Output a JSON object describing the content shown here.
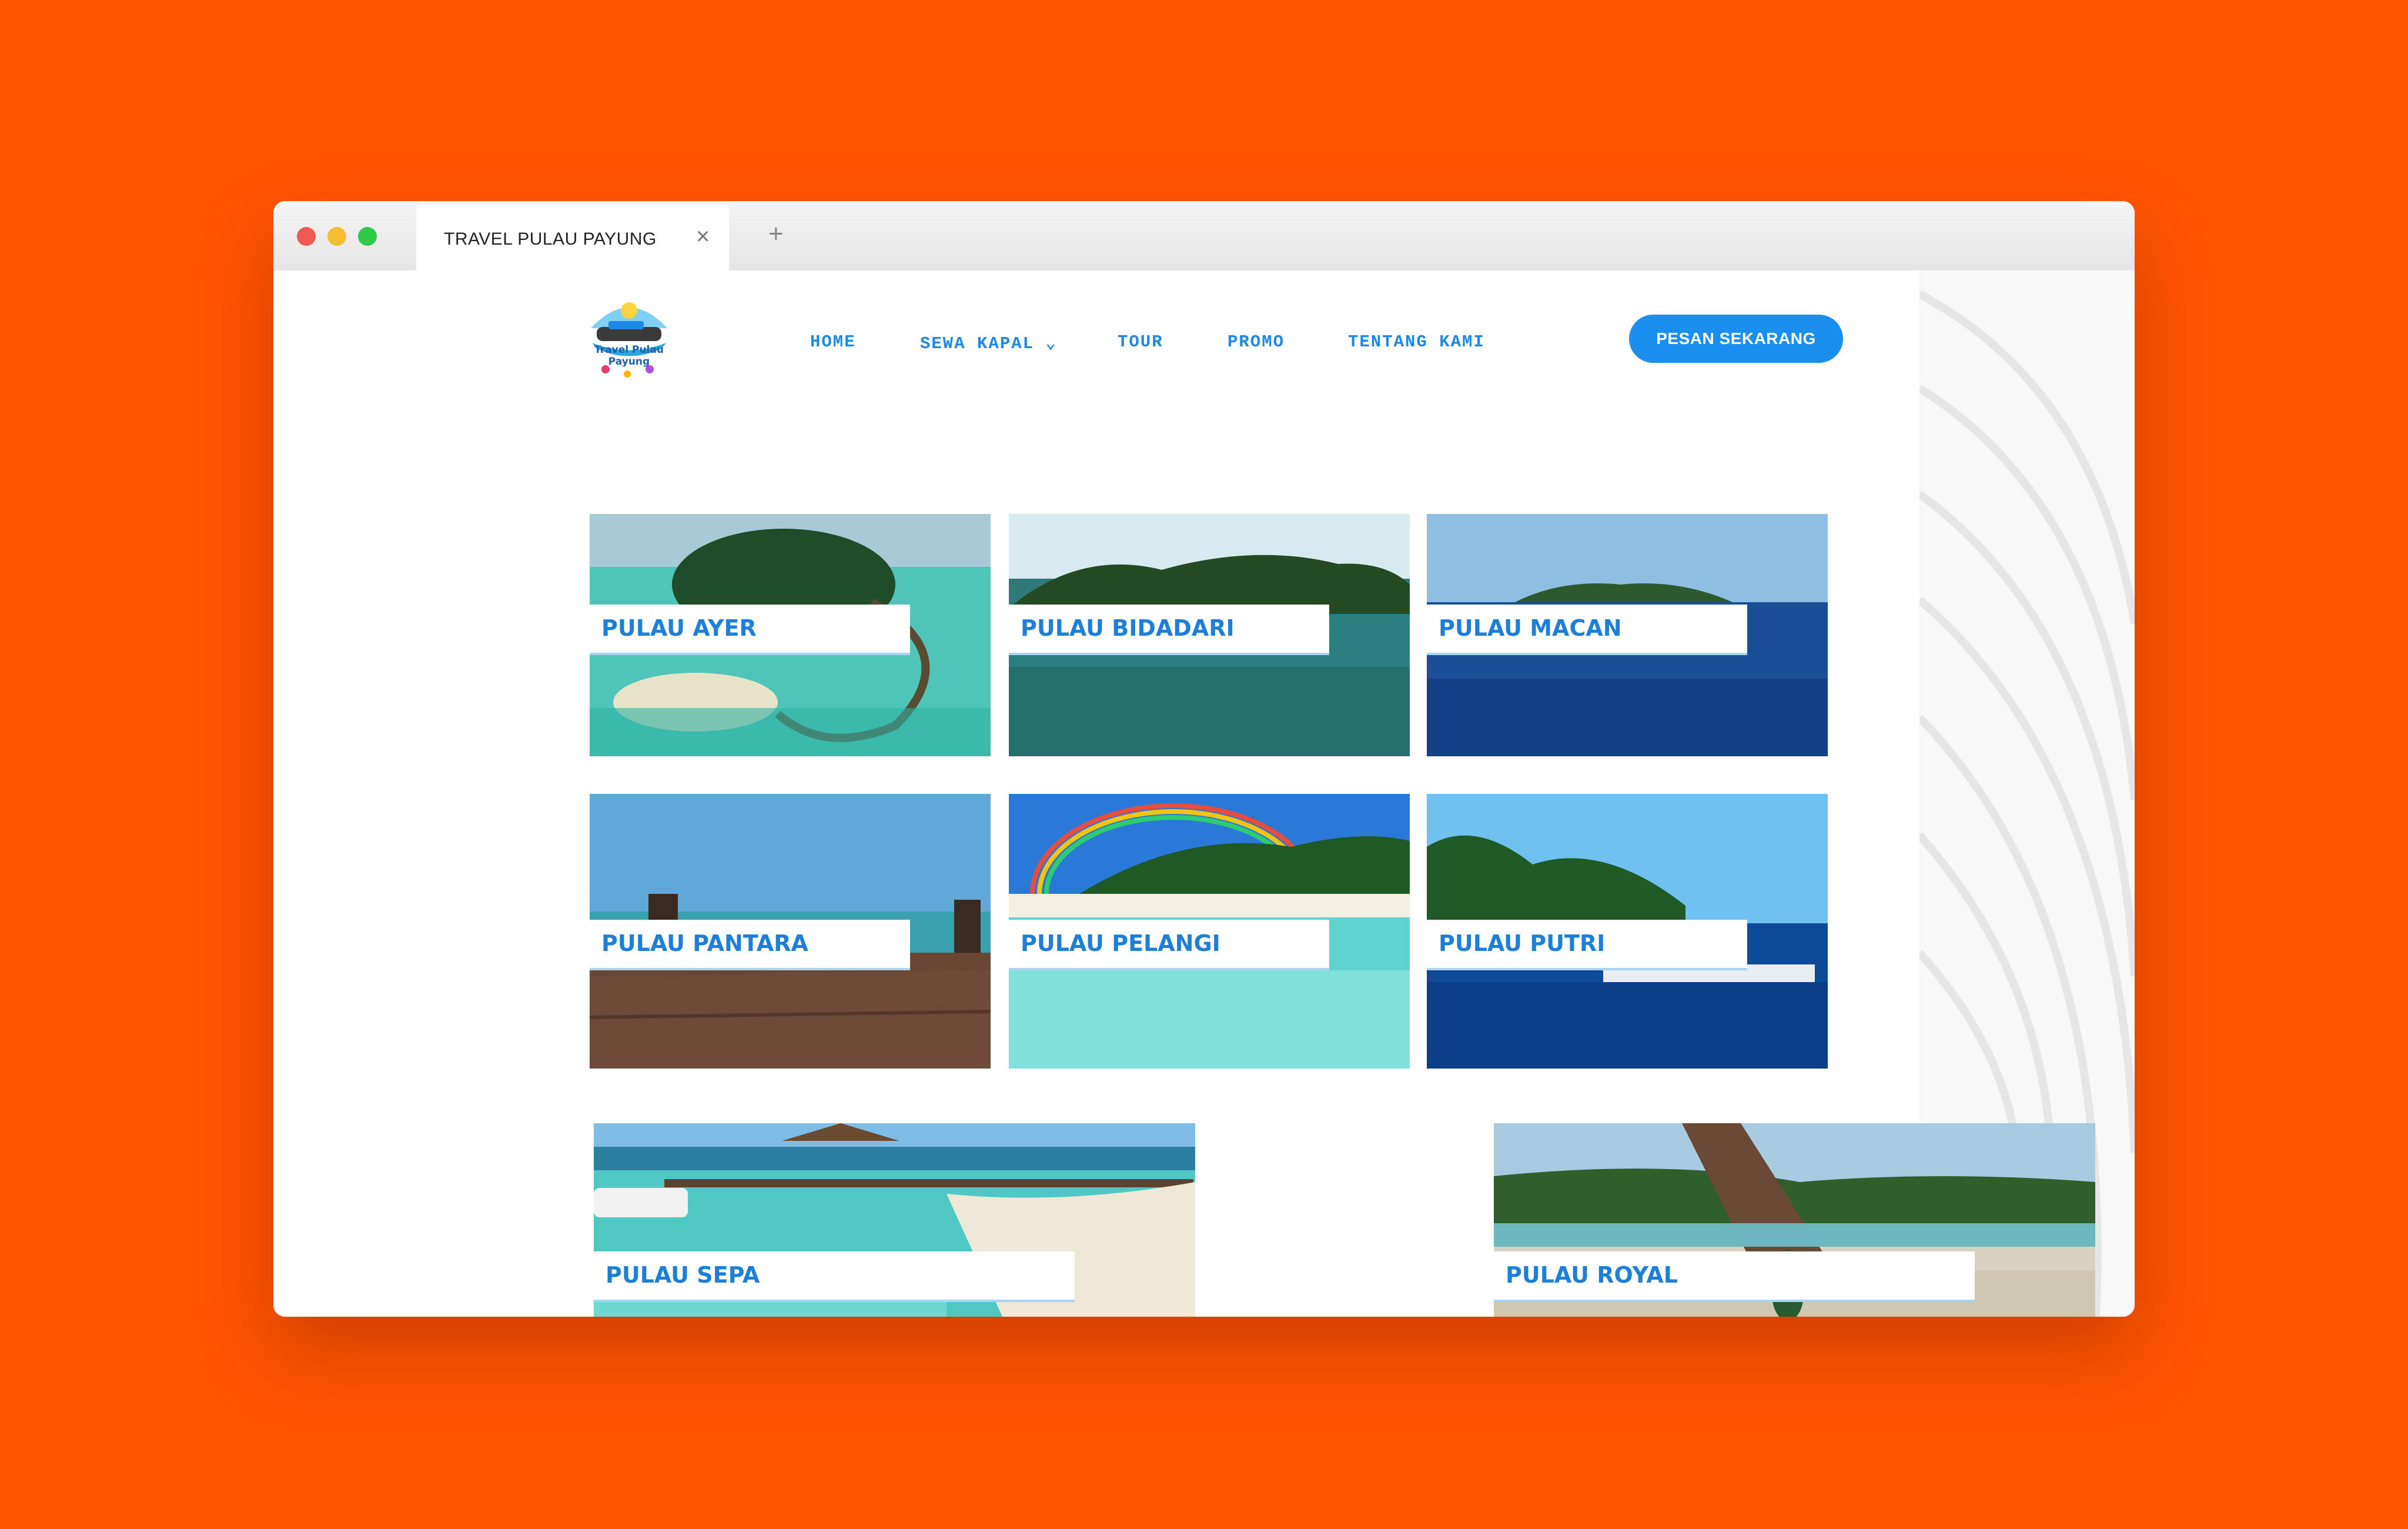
{
  "browser": {
    "tab_title": "TRAVEL PULAU PAYUNG",
    "close_glyph": "×",
    "new_tab_glyph": "+"
  },
  "logo": {
    "text_line1": "Travel Pulau",
    "text_line2": "Payung"
  },
  "nav": {
    "home": "HOME",
    "sewa_kapal": "SEWA KAPAL ⌄",
    "tour": "TOUR",
    "promo": "PROMO",
    "tentang_kami": "TENTANG KAMI"
  },
  "cta": {
    "label": "PESAN SEKARANG"
  },
  "islands": [
    {
      "name": "PULAU AYER"
    },
    {
      "name": "PULAU BIDADARI"
    },
    {
      "name": "PULAU MACAN"
    },
    {
      "name": "PULAU PANTARA"
    },
    {
      "name": "PULAU PELANGI"
    },
    {
      "name": "PULAU PUTRI"
    },
    {
      "name": "PULAU SEPA"
    },
    {
      "name": "PULAU ROYAL"
    }
  ],
  "colors": {
    "background": "#ff5500",
    "accent": "#1e88e5",
    "button": "#1a8ff0"
  }
}
